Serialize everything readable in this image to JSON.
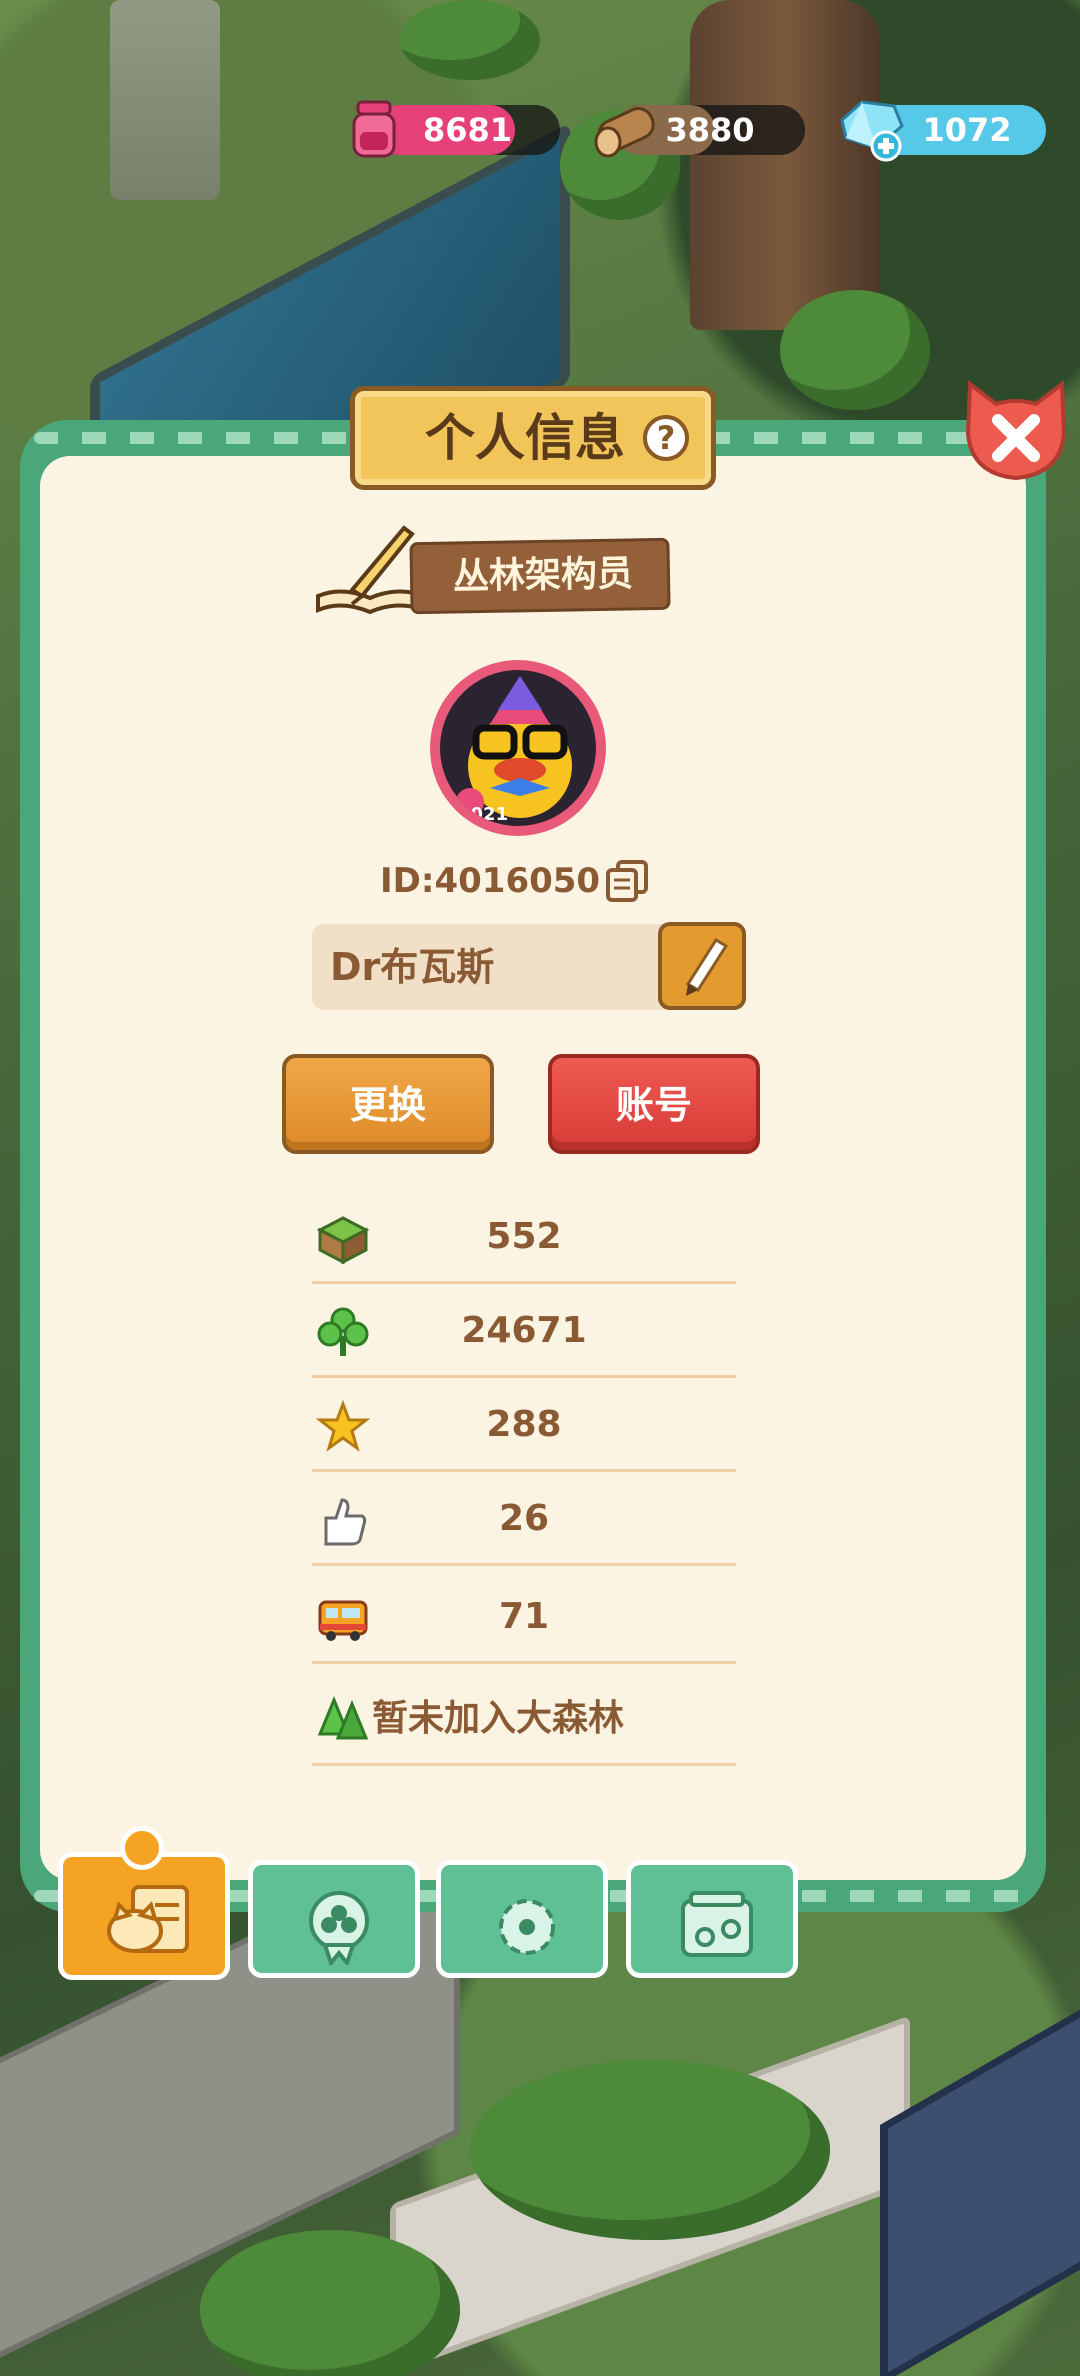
{
  "resources": {
    "ink": "8681",
    "wood": "3880",
    "gems": "1072"
  },
  "panel": {
    "title": "个人信息",
    "help": "?",
    "rank": "丛林架构员",
    "avatar_badge": "2021",
    "id_label": "ID:4016050",
    "name": "Dr布瓦斯",
    "buttons": {
      "change": "更换",
      "account": "账号"
    },
    "stats": [
      {
        "icon": "grass-block-icon",
        "value": "552"
      },
      {
        "icon": "clover-icon",
        "value": "24671"
      },
      {
        "icon": "star-icon",
        "value": "288"
      },
      {
        "icon": "thumbs-up-icon",
        "value": "26"
      },
      {
        "icon": "bus-icon",
        "value": "71"
      }
    ],
    "forest_status": "暂未加入大森林"
  },
  "tabs": [
    {
      "name": "profile",
      "active": true
    },
    {
      "name": "badges",
      "active": false
    },
    {
      "name": "settings",
      "active": false
    },
    {
      "name": "album",
      "active": false
    }
  ],
  "colors": {
    "panel_green": "#4aa77a",
    "panel_cream": "#fbf4e3",
    "title_gold": "#f2c55a",
    "button_orange": "#e39a2f",
    "button_red": "#d83b37",
    "text_brown": "#8a5a35",
    "tab_active": "#f5a322",
    "tab_inactive": "#5fbf95"
  }
}
